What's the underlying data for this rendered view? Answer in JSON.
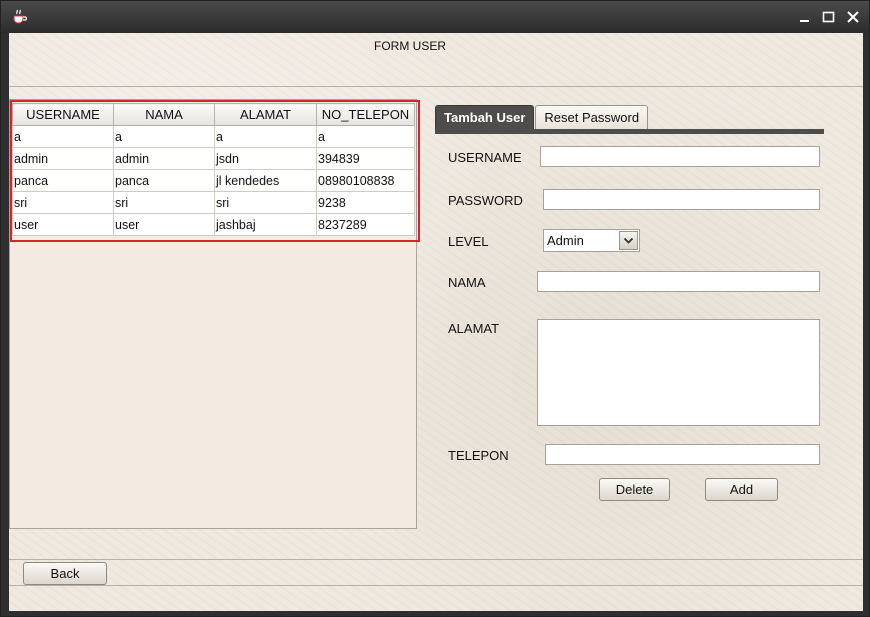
{
  "window": {
    "title": "FORM USER"
  },
  "table": {
    "columns": [
      "USERNAME",
      "NAMA",
      "ALAMAT",
      "NO_TELEPON"
    ],
    "rows": [
      [
        "a",
        "a",
        "a",
        "a"
      ],
      [
        "admin",
        "admin",
        "jsdn",
        "394839"
      ],
      [
        "panca",
        "panca",
        "jl kendedes",
        "08980108838"
      ],
      [
        "sri",
        "sri",
        "sri",
        "9238"
      ],
      [
        "user",
        "user",
        "jashbaj",
        "8237289"
      ]
    ]
  },
  "tabs": [
    {
      "label": "Tambah User",
      "active": true
    },
    {
      "label": "Reset Password",
      "active": false
    }
  ],
  "form": {
    "username_label": "USERNAME",
    "username_value": "",
    "password_label": "PASSWORD",
    "password_value": "",
    "level_label": "LEVEL",
    "level_selected": "Admin",
    "nama_label": "NAMA",
    "nama_value": "",
    "alamat_label": "ALAMAT",
    "alamat_value": "",
    "telepon_label": "TELEPON",
    "telepon_value": ""
  },
  "buttons": {
    "delete": "Delete",
    "add": "Add",
    "back": "Back"
  },
  "icons": {
    "app": "java-cup-icon",
    "minimize": "minimize-icon",
    "maximize": "maximize-icon",
    "close": "close-icon",
    "dropdown": "chevron-down-icon"
  },
  "colors": {
    "highlight": "#d9232b",
    "active_tab": "#4e4d4b"
  }
}
